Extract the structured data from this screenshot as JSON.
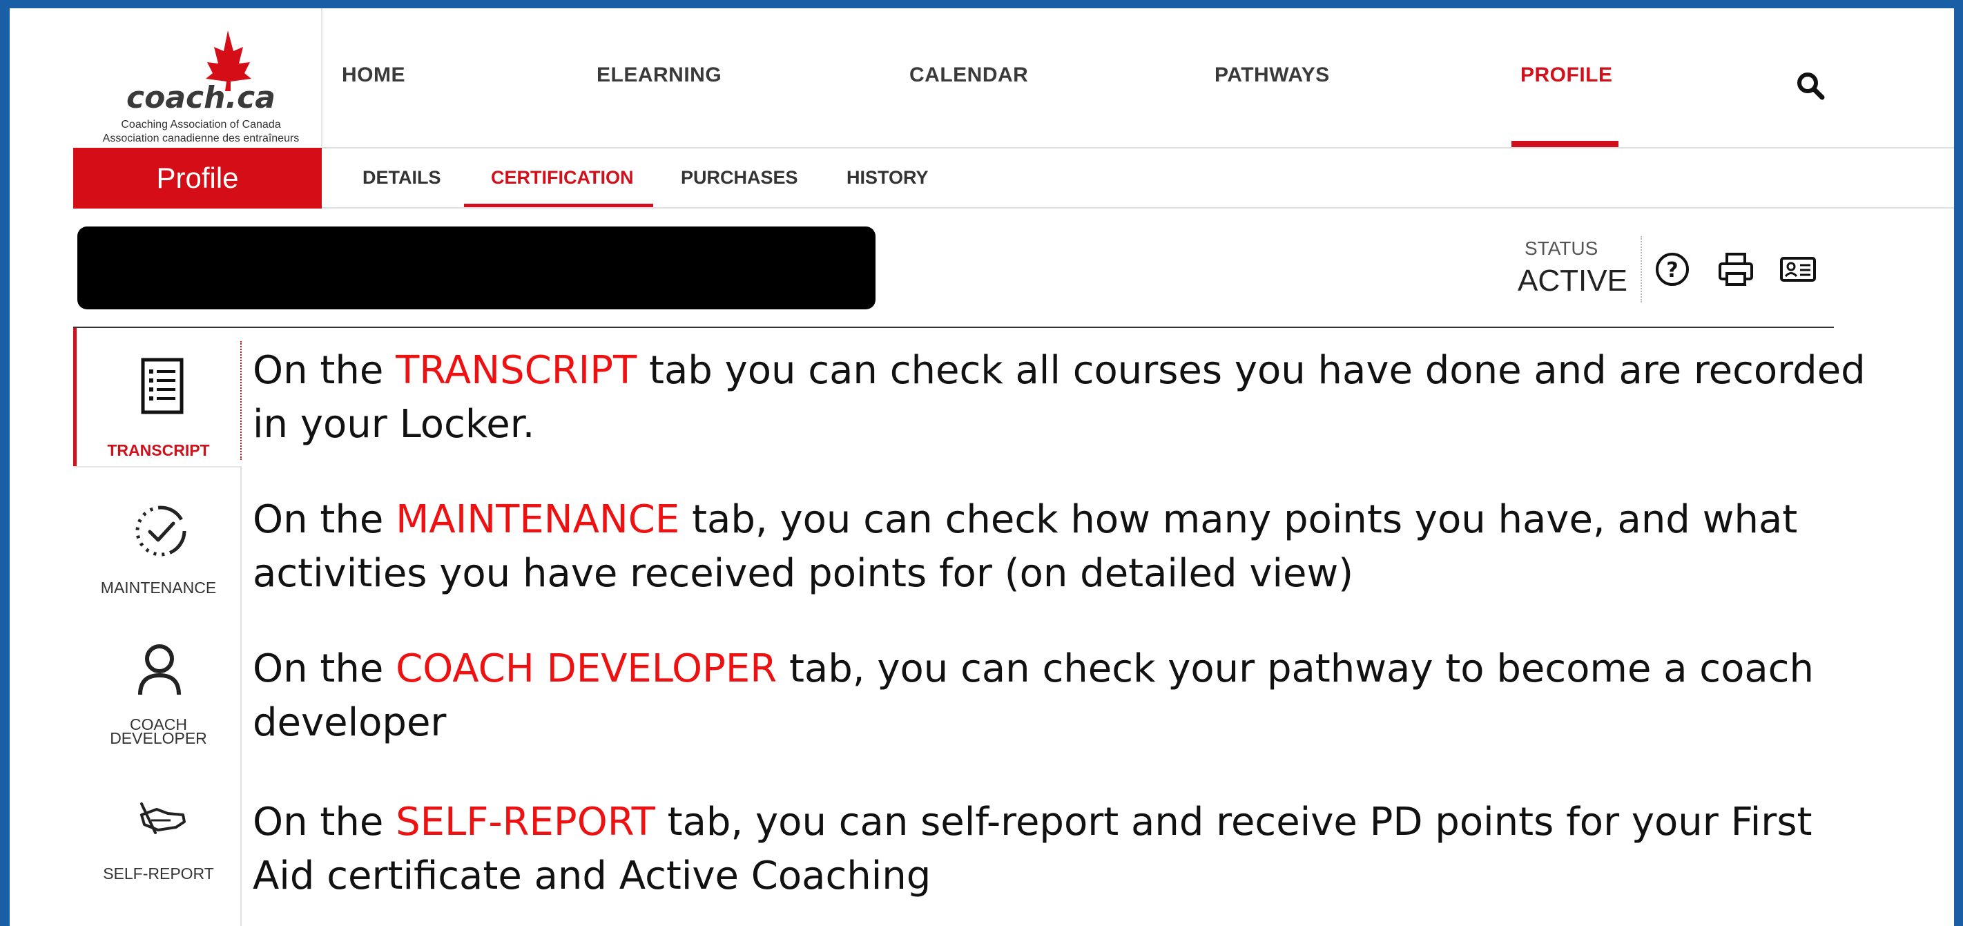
{
  "logo": {
    "brand_text": "coach.ca",
    "tagline_en": "Coaching Association of Canada",
    "tagline_fr": "Association canadienne des entraîneurs"
  },
  "nav": {
    "items": [
      {
        "label": "HOME"
      },
      {
        "label": "ELEARNING"
      },
      {
        "label": "CALENDAR"
      },
      {
        "label": "PATHWAYS"
      },
      {
        "label": "PROFILE",
        "active": true
      }
    ],
    "search_icon": "search-icon"
  },
  "subnav": {
    "section_title": "Profile",
    "tabs": [
      {
        "label": "DETAILS"
      },
      {
        "label": "CERTIFICATION",
        "active": true
      },
      {
        "label": "PURCHASES"
      },
      {
        "label": "HISTORY"
      }
    ]
  },
  "status": {
    "label": "STATUS",
    "value": "ACTIVE",
    "icons": [
      "help-icon",
      "print-icon",
      "id-card-icon"
    ]
  },
  "side_tabs": [
    {
      "label": "TRANSCRIPT",
      "icon": "list-document-icon",
      "active": true
    },
    {
      "label": "MAINTENANCE",
      "icon": "dashed-check-icon"
    },
    {
      "label_line1": "COACH",
      "label_line2": "DEVELOPER",
      "icon": "person-icon"
    },
    {
      "label": "SELF-REPORT",
      "icon": "hand-icon"
    }
  ],
  "notes": [
    {
      "pre": "On the ",
      "highlight": "TRANSCRIPT",
      "post": " tab you can check all courses you have done and are recorded in your Locker."
    },
    {
      "pre": "On the ",
      "highlight": "MAINTENANCE",
      "post": " tab, you can check how many points you have, and what activities you have received points for (on detailed view)"
    },
    {
      "pre": "On the ",
      "highlight": "COACH DEVELOPER",
      "post": " tab, you can check your pathway to become a coach developer"
    },
    {
      "pre": "On the ",
      "highlight": "SELF-REPORT",
      "post": " tab, you can self-report and receive PD points for your First Aid certificate and Active Coaching"
    }
  ],
  "colors": {
    "accent": "#d0111b",
    "annotation_highlight": "#ee1111",
    "frame_border": "#1a5fa6"
  }
}
